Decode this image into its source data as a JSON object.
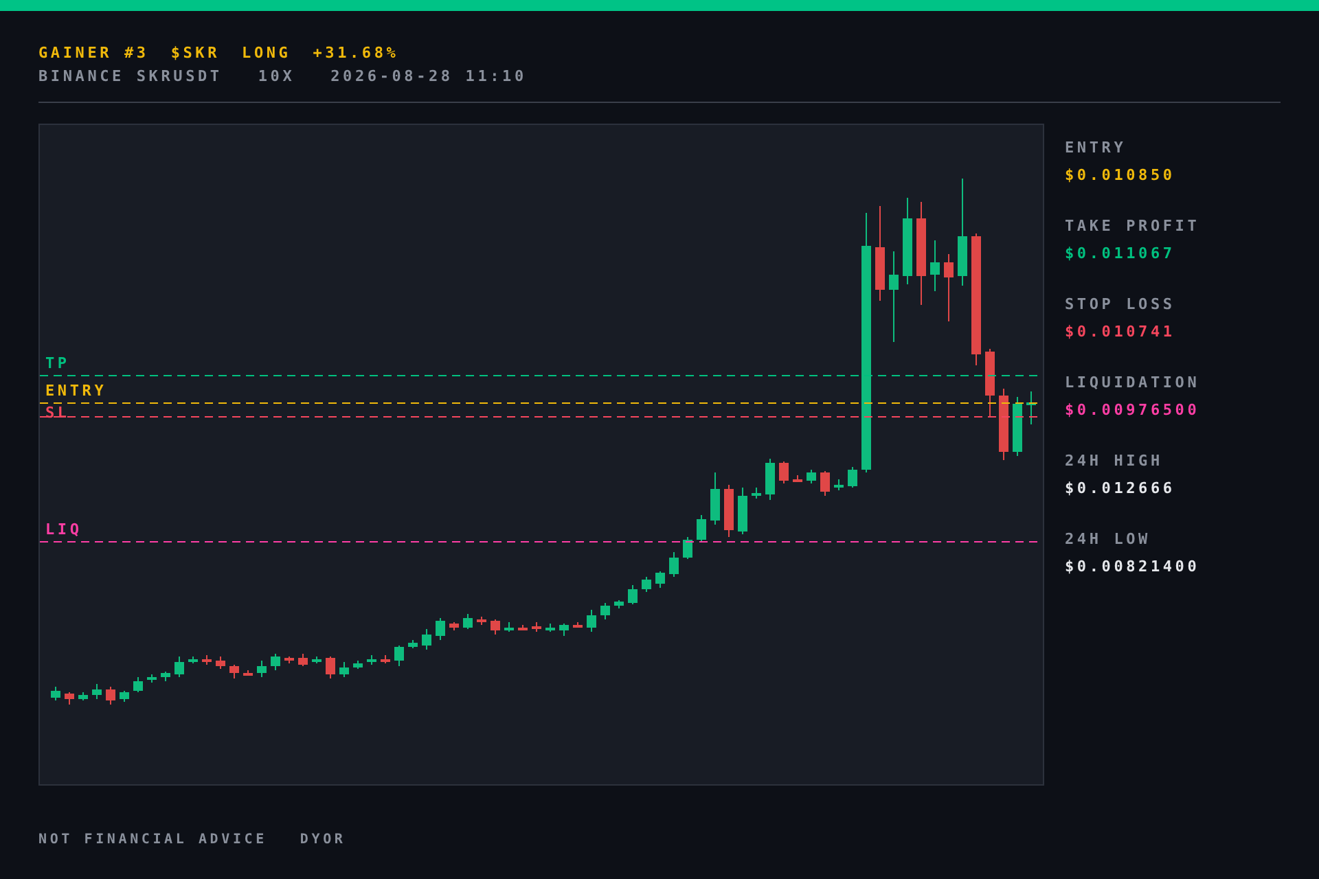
{
  "header": {
    "title": [
      "GAINER #3",
      "$SKR",
      "LONG",
      "+31.68%"
    ],
    "subtitle": [
      "BINANCE SKRUSDT",
      "10X",
      "2026-08-28 11:10"
    ]
  },
  "chart": {
    "levels": [
      {
        "kind": "tp",
        "label": "TP",
        "color": "#00c07f"
      },
      {
        "kind": "entry",
        "label": "ENTRY",
        "color": "#f0b90b"
      },
      {
        "kind": "sl",
        "label": "SL",
        "color": "#f6465d"
      },
      {
        "kind": "liq",
        "label": "LIQ",
        "color": "#ff3ea5"
      }
    ]
  },
  "stats": [
    {
      "label": "ENTRY",
      "value": "$0.010850",
      "color": "#f0b90b"
    },
    {
      "label": "TAKE PROFIT",
      "value": "$0.011067",
      "color": "#00c07f"
    },
    {
      "label": "STOP LOSS",
      "value": "$0.010741",
      "color": "#f6465d"
    },
    {
      "label": "LIQUIDATION",
      "value": "$0.00976500",
      "color": "#ff3ea5"
    },
    {
      "label": "24H HIGH",
      "value": "$0.012666",
      "color": "#e6e8ec"
    },
    {
      "label": "24H LOW",
      "value": "$0.00821400",
      "color": "#e6e8ec"
    }
  ],
  "footer": [
    "NOT FINANCIAL ADVICE",
    "DYOR"
  ]
}
